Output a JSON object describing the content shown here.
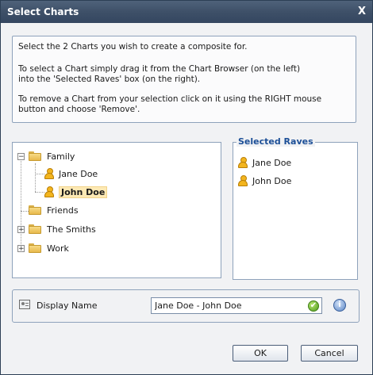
{
  "window": {
    "title": "Select Charts",
    "close_glyph": "X"
  },
  "instructions": {
    "line1": "Select the 2 Charts you wish to create a composite for.",
    "line2": "To select a Chart simply drag it from the Chart Browser (on the left)",
    "line3": "into the 'Selected Raves' box (on the right).",
    "line4": "To remove a Chart from your selection click on it using the RIGHT mouse",
    "line5": "button and choose 'Remove'."
  },
  "tree": {
    "family": {
      "label": "Family",
      "expander": "−"
    },
    "jane": {
      "label": "Jane Doe"
    },
    "john": {
      "label": "John Doe"
    },
    "friends": {
      "label": "Friends"
    },
    "smiths": {
      "label": "The Smiths",
      "expander": "+"
    },
    "work": {
      "label": "Work",
      "expander": "+"
    }
  },
  "selected": {
    "legend": "Selected Raves",
    "items": [
      "Jane Doe",
      "John Doe"
    ]
  },
  "display_name": {
    "label": "Display Name",
    "value": "Jane Doe - John Doe",
    "check_glyph": "✔",
    "info_glyph": "i"
  },
  "buttons": {
    "ok": "OK",
    "cancel": "Cancel"
  },
  "colors": {
    "title_bar": "#3e5068",
    "legend": "#1c4f97",
    "selection": "#fde9b4"
  }
}
